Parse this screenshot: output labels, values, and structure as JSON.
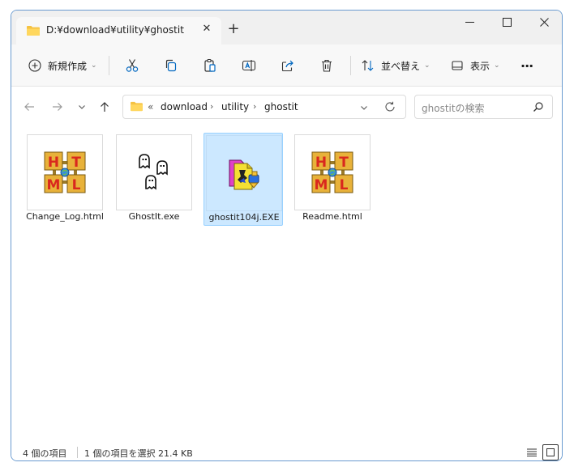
{
  "window": {
    "tab_title": "D:¥download¥utility¥ghostit",
    "tab_close": "✕",
    "new_tab": "+"
  },
  "toolbar": {
    "new_label": "新規作成",
    "sort_label": "並べ替え",
    "view_label": "表示",
    "more_label": "···"
  },
  "address": {
    "overflow": "«",
    "crumbs": [
      "download",
      "utility",
      "ghostit"
    ],
    "separator": "›"
  },
  "search": {
    "placeholder": "ghostitの検索"
  },
  "files": [
    {
      "name": "Change_Log.html",
      "icon": "html-file-icon"
    },
    {
      "name": "GhostIt.exe",
      "icon": "ghost-file-icon"
    },
    {
      "name": "ghostit104j.EXE",
      "icon": "installer-file-icon",
      "selected": true
    },
    {
      "name": "Readme.html",
      "icon": "html-file-icon"
    }
  ],
  "status": {
    "item_count": "4 個の項目",
    "selection": "1 個の項目を選択  21.4 KB"
  },
  "colors": {
    "accent": "#0067c0",
    "selection_bg": "#cce8ff",
    "selection_border": "#99d1ff",
    "folder": "#f5c242"
  }
}
